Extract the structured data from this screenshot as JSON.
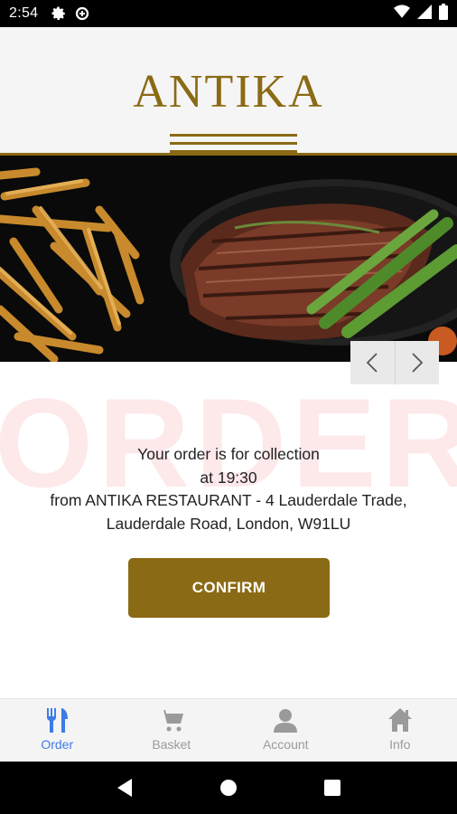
{
  "status_bar": {
    "time": "2:54"
  },
  "header": {
    "logo": "ANTIKA"
  },
  "watermark": "ORDER",
  "message": {
    "line1": "Your order is for collection",
    "line2": "at 19:30",
    "line3": "from ANTIKA RESTAURANT - 4 Lauderdale Trade,",
    "line4": "Lauderdale Road, London, W91LU"
  },
  "confirm_label": "CONFIRM",
  "bottom_nav": {
    "tabs": [
      {
        "label": "Order",
        "icon": "fork-knife-icon",
        "active": true
      },
      {
        "label": "Basket",
        "icon": "cart-icon",
        "active": false
      },
      {
        "label": "Account",
        "icon": "person-icon",
        "active": false
      },
      {
        "label": "Info",
        "icon": "home-icon",
        "active": false
      }
    ]
  },
  "colors": {
    "brand": "#8a6a14",
    "active_tab": "#3d7ce8",
    "inactive_tab": "#9a9a9a"
  }
}
